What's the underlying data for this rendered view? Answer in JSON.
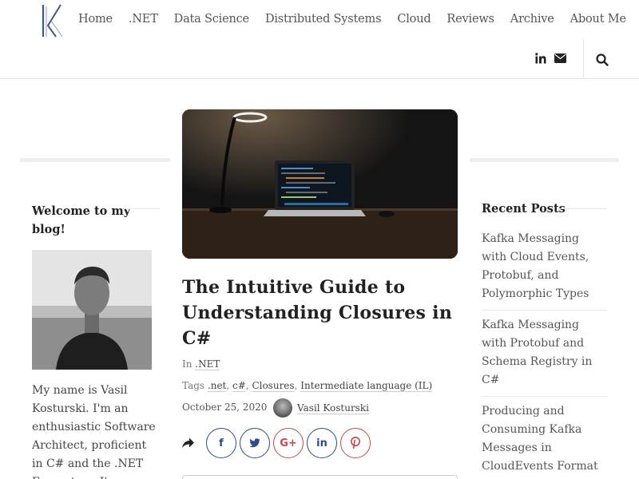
{
  "nav": {
    "items": [
      "Home",
      ".NET",
      "Data Science",
      "Distributed Systems",
      "Cloud",
      "Reviews",
      "Archive",
      "About Me"
    ]
  },
  "header": {
    "social_icons": [
      "linkedin-icon",
      "mail-icon"
    ],
    "search_icon": "search-icon"
  },
  "sidebar_left": {
    "title": "Welcome to my blog!",
    "bio": "My name is Vasil Kosturski. I'm an enthusiastic Software Architect, proficient in C# and the .NET Ecosystem. I'm"
  },
  "post": {
    "title": "The Intuitive Guide to Understanding Closures in C#",
    "category_prefix": "In",
    "category": ".NET",
    "tags_prefix": "Tags",
    "tags": [
      ".net",
      "c#",
      "Closures",
      "Intermediate language (IL)"
    ],
    "date": "October 25, 2020",
    "author": "Vasil Kosturski",
    "share_buttons": [
      {
        "label": "f",
        "icon": "facebook-icon"
      },
      {
        "label": "🐦",
        "icon": "twitter-icon"
      },
      {
        "label": "G+",
        "icon": "google-plus-icon"
      },
      {
        "label": "in",
        "icon": "linkedin-icon"
      },
      {
        "label": "P",
        "icon": "pinterest-icon"
      }
    ]
  },
  "sidebar_right": {
    "title": "Recent Posts",
    "posts": [
      "Kafka Messaging with Cloud Events, Protobuf, and Polymorphic Types",
      "Kafka Messaging with Protobuf and Schema Registry in C#",
      "Producing and Consuming Kafka Messages in CloudEvents Format Using the C# SDK"
    ]
  },
  "colors": {
    "share_blue": "#2b4b8c",
    "share_red": "#d04545"
  }
}
